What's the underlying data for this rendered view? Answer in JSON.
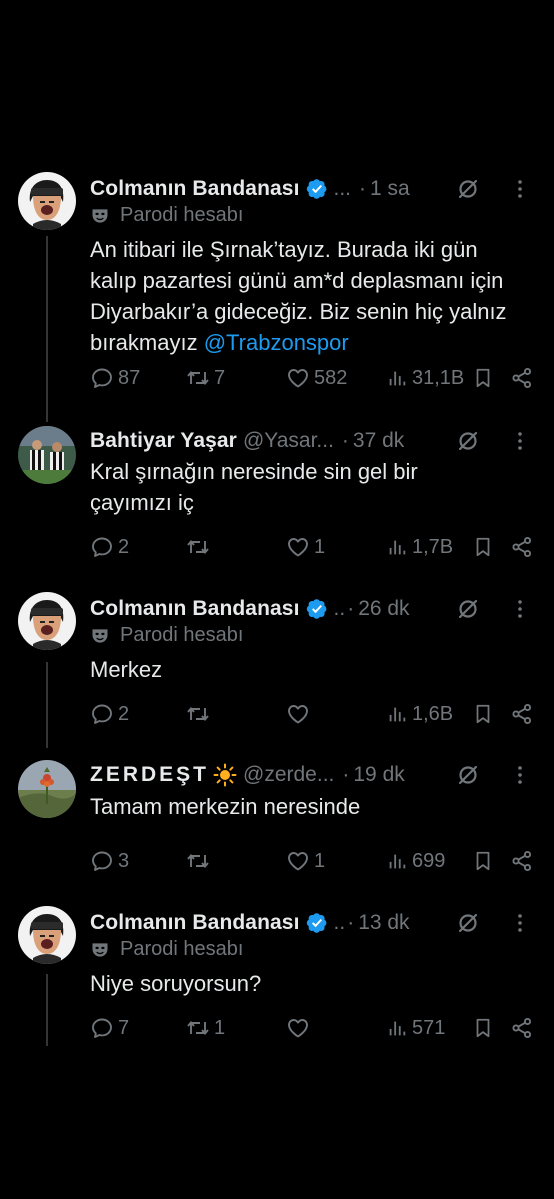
{
  "tweets": [
    {
      "name": "Colmanın Bandanası",
      "handle": "...",
      "dot": "·",
      "time": "1 sa",
      "parody": "Parodi hesabı",
      "text_prefix": "An itibari ile Şırnak’tayız. Burada iki gün kalıp pazartesi günü am*d deplasmanı için Diyarbakır’a gideceğiz. Biz senin hiç yalnız bırakmayız ",
      "mention": "@Trabzonspor",
      "replies": "87",
      "retweets": "7",
      "likes": "582",
      "views": "31,1B"
    },
    {
      "name": "Bahtiyar Yaşar",
      "handle": "@Yasar...",
      "dot": "·",
      "time": "37 dk",
      "text": "Kral şırnağın neresinde sin gel bir çayımızı iç",
      "replies": "2",
      "retweets": "",
      "likes": "1",
      "views": "1,7B"
    },
    {
      "name": "Colmanın Bandanası",
      "handle": "..",
      "dot": "·",
      "time": "26 dk",
      "parody": "Parodi hesabı",
      "text": "Merkez",
      "replies": "2",
      "retweets": "",
      "likes": "",
      "views": "1,6B"
    },
    {
      "name": "ZERDEŞT",
      "handle": "@zerde...",
      "dot": "·",
      "time": "19 dk",
      "text": "Tamam merkezin neresinde",
      "replies": "3",
      "retweets": "",
      "likes": "1",
      "views": "699"
    },
    {
      "name": "Colmanın Bandanası",
      "handle": "..",
      "dot": "·",
      "time": "13 dk",
      "parody": "Parodi hesabı",
      "text": "Niye soruyorsun?",
      "replies": "7",
      "retweets": "1",
      "likes": "",
      "views": "571"
    }
  ],
  "colors": {
    "background": "#000000",
    "text": "#e7e9ea",
    "muted": "#71767b",
    "accent": "#1d9bf0",
    "thread_line": "#333639"
  },
  "icons": {
    "verified": "verified-badge-icon",
    "grok": "grok-icon",
    "more": "more-icon",
    "parody": "theater-mask-icon",
    "reply": "reply-icon",
    "retweet": "retweet-icon",
    "like": "heart-icon",
    "views": "views-icon",
    "bookmark": "bookmark-icon",
    "share": "share-icon"
  }
}
